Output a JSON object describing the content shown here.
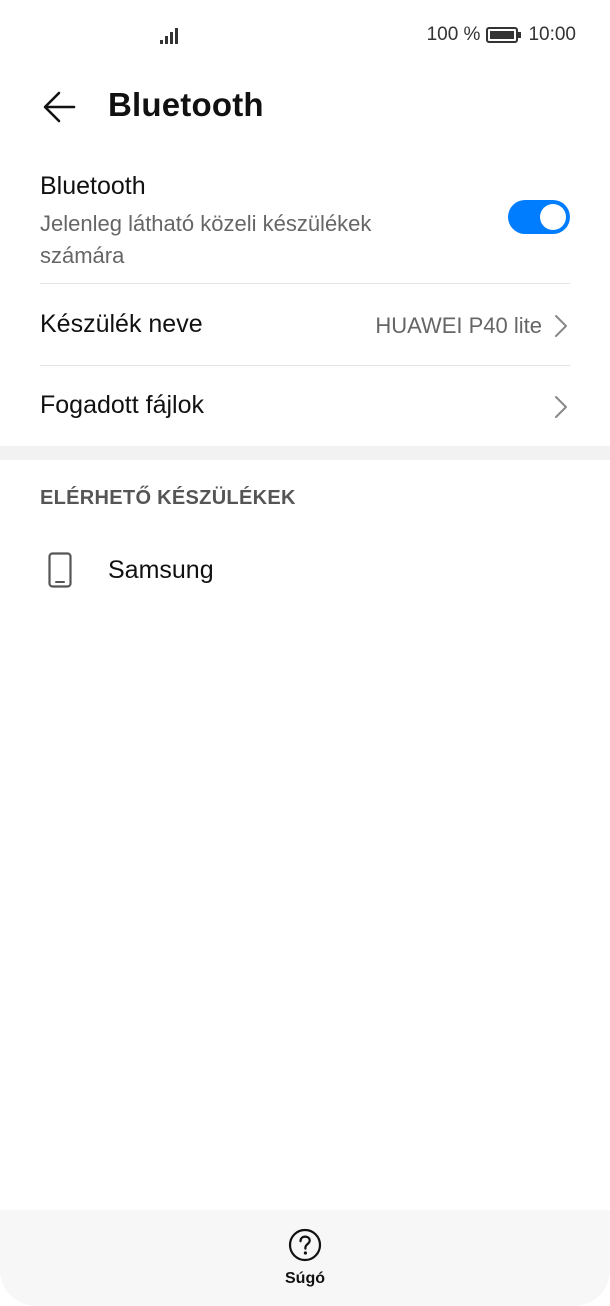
{
  "status_bar": {
    "signal_icon": "signal-bars-icon",
    "battery_percent": "100 %",
    "battery_icon": "battery-full-icon",
    "time": "10:00"
  },
  "header": {
    "back_icon": "arrow-left-icon",
    "title": "Bluetooth"
  },
  "bluetooth_row": {
    "title": "Bluetooth",
    "subtitle": "Jelenleg látható közeli készülékek számára",
    "toggle_on": true,
    "accent_color": "#007dff"
  },
  "device_name_row": {
    "label": "Készülék neve",
    "value": "HUAWEI P40 lite",
    "chevron_icon": "chevron-right-icon"
  },
  "received_files_row": {
    "label": "Fogadott fájlok",
    "chevron_icon": "chevron-right-icon"
  },
  "available_devices": {
    "header": "ELÉRHETŐ KÉSZÜLÉKEK",
    "items": [
      {
        "icon": "phone-icon",
        "name": "Samsung"
      }
    ]
  },
  "bottom_bar": {
    "help_icon": "question-circle-icon",
    "help_label": "Súgó"
  }
}
